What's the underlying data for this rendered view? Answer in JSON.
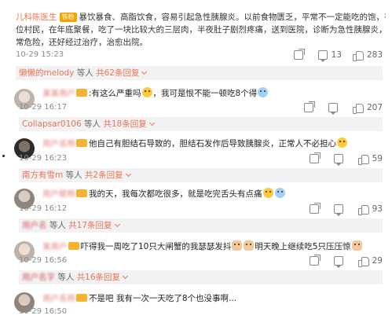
{
  "post": {
    "author": "儿科陈医生",
    "badge": "铁粉",
    "text_line1": "暴饮暴食、高脂饮食，容易引起急性胰腺炎。以前食物匮乏，平常不一定能吃的饱，有",
    "text_line2": "位村民，在年底聚餐，吃了一块比较大的三层肉，半夜肚子剧烈疼痛，送到医院，诊断为急性胰腺炎，非",
    "text_line3": "常危险，还好经过治疗，治愈出院。",
    "time": "10-29 15:23",
    "comments_count": "13",
    "likes": "283",
    "reply_user": "懒懒的melody",
    "reply_text": "等人",
    "reply_count": "共62条回复"
  },
  "comments": [
    {
      "name": "",
      "text": ":有这么严重吗",
      "text2": "，我可是恨不能一顿吃8个得",
      "time": "10-29 16:17",
      "comments_count": "",
      "likes": "207",
      "reply_user": "Collapsar0106",
      "reply_text": "等人",
      "reply_count": "共18条回复"
    },
    {
      "name": "",
      "text": "他自己有胆结石导致的，胆结石发作后导致胰腺炎，正常人不必担心",
      "time": "10-29 16:23",
      "comments_count": "",
      "likes": "59",
      "reply_user": "南方有雪m",
      "reply_text": "等人",
      "reply_count": "共2条回复"
    },
    {
      "name": "",
      "text": "我的天，我每次都吃很多，就是吃完舌头有点痛",
      "time": "10-29 16:12",
      "comments_count": "",
      "likes": "93",
      "reply_user": "",
      "reply_text": "等人",
      "reply_count": "共17条回复"
    },
    {
      "name": "",
      "text": "吓得我一周吃了10只大闸蟹的我瑟瑟发抖",
      "text2": "明天晚上继续吃5只压压惊",
      "time": "10-29 16:56",
      "comments_count": "",
      "likes": "29",
      "reply_user": "",
      "reply_text": "等人",
      "reply_count": "共16条回复"
    },
    {
      "name": "",
      "text": "不是吧 我有一次一天吃了8个也没事啊...",
      "time": "10-29 16:50"
    }
  ]
}
